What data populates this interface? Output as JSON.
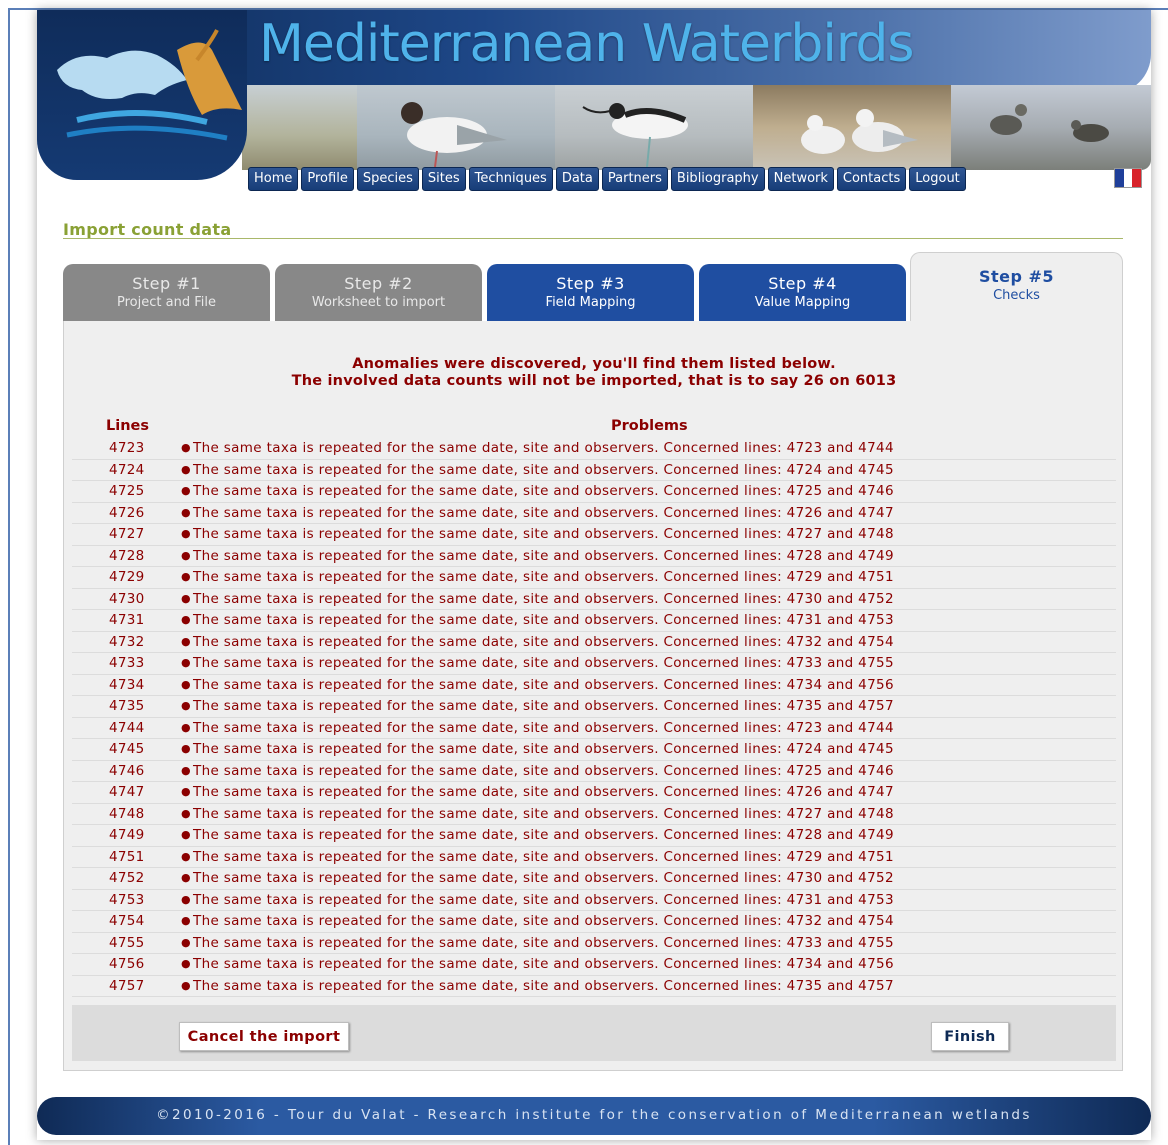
{
  "header": {
    "site_title": "Mediterranean Waterbirds",
    "nav": [
      "Home",
      "Profile",
      "Species",
      "Sites",
      "Techniques",
      "Data",
      "Partners",
      "Bibliography",
      "Network",
      "Contacts",
      "Logout"
    ],
    "flag_icon": "french-flag-icon",
    "colors": {
      "title": "#4fb3ea",
      "nav_bg": "#1f4687"
    }
  },
  "page": {
    "title": "Import count data"
  },
  "steps": [
    {
      "title": "Step #1",
      "subtitle": "Project and File",
      "state": "done"
    },
    {
      "title": "Step #2",
      "subtitle": "Worksheet to import",
      "state": "done"
    },
    {
      "title": "Step #3",
      "subtitle": "Field Mapping",
      "state": "completed"
    },
    {
      "title": "Step #4",
      "subtitle": "Value Mapping",
      "state": "completed"
    },
    {
      "title": "Step #5",
      "subtitle": "Checks",
      "state": "current"
    }
  ],
  "anomalies": {
    "message_line1": "Anomalies were discovered, you'll find them listed below.",
    "message_line2": "The involved data counts will not be imported, that is to say 26 on 6013",
    "headers": {
      "lines": "Lines",
      "problems": "Problems"
    },
    "rows": [
      {
        "line": "4723",
        "problem": "The same taxa is repeated for the same date, site and observers. Concerned lines: 4723 and 4744"
      },
      {
        "line": "4724",
        "problem": "The same taxa is repeated for the same date, site and observers. Concerned lines: 4724 and 4745"
      },
      {
        "line": "4725",
        "problem": "The same taxa is repeated for the same date, site and observers. Concerned lines: 4725 and 4746"
      },
      {
        "line": "4726",
        "problem": "The same taxa is repeated for the same date, site and observers. Concerned lines: 4726 and 4747"
      },
      {
        "line": "4727",
        "problem": "The same taxa is repeated for the same date, site and observers. Concerned lines: 4727 and 4748"
      },
      {
        "line": "4728",
        "problem": "The same taxa is repeated for the same date, site and observers. Concerned lines: 4728 and 4749"
      },
      {
        "line": "4729",
        "problem": "The same taxa is repeated for the same date, site and observers. Concerned lines: 4729 and 4751"
      },
      {
        "line": "4730",
        "problem": "The same taxa is repeated for the same date, site and observers. Concerned lines: 4730 and 4752"
      },
      {
        "line": "4731",
        "problem": "The same taxa is repeated for the same date, site and observers. Concerned lines: 4731 and 4753"
      },
      {
        "line": "4732",
        "problem": "The same taxa is repeated for the same date, site and observers. Concerned lines: 4732 and 4754"
      },
      {
        "line": "4733",
        "problem": "The same taxa is repeated for the same date, site and observers. Concerned lines: 4733 and 4755"
      },
      {
        "line": "4734",
        "problem": "The same taxa is repeated for the same date, site and observers. Concerned lines: 4734 and 4756"
      },
      {
        "line": "4735",
        "problem": "The same taxa is repeated for the same date, site and observers. Concerned lines: 4735 and 4757"
      },
      {
        "line": "4744",
        "problem": "The same taxa is repeated for the same date, site and observers. Concerned lines: 4723 and 4744"
      },
      {
        "line": "4745",
        "problem": "The same taxa is repeated for the same date, site and observers. Concerned lines: 4724 and 4745"
      },
      {
        "line": "4746",
        "problem": "The same taxa is repeated for the same date, site and observers. Concerned lines: 4725 and 4746"
      },
      {
        "line": "4747",
        "problem": "The same taxa is repeated for the same date, site and observers. Concerned lines: 4726 and 4747"
      },
      {
        "line": "4748",
        "problem": "The same taxa is repeated for the same date, site and observers. Concerned lines: 4727 and 4748"
      },
      {
        "line": "4749",
        "problem": "The same taxa is repeated for the same date, site and observers. Concerned lines: 4728 and 4749"
      },
      {
        "line": "4751",
        "problem": "The same taxa is repeated for the same date, site and observers. Concerned lines: 4729 and 4751"
      },
      {
        "line": "4752",
        "problem": "The same taxa is repeated for the same date, site and observers. Concerned lines: 4730 and 4752"
      },
      {
        "line": "4753",
        "problem": "The same taxa is repeated for the same date, site and observers. Concerned lines: 4731 and 4753"
      },
      {
        "line": "4754",
        "problem": "The same taxa is repeated for the same date, site and observers. Concerned lines: 4732 and 4754"
      },
      {
        "line": "4755",
        "problem": "The same taxa is repeated for the same date, site and observers. Concerned lines: 4733 and 4755"
      },
      {
        "line": "4756",
        "problem": "The same taxa is repeated for the same date, site and observers. Concerned lines: 4734 and 4756"
      },
      {
        "line": "4757",
        "problem": "The same taxa is repeated for the same date, site and observers. Concerned lines: 4735 and 4757"
      }
    ]
  },
  "actions": {
    "cancel_label": "Cancel the import",
    "finish_label": "Finish"
  },
  "footer": {
    "text": "©2010-2016 - Tour du Valat - Research institute for the conservation of Mediterranean wetlands"
  }
}
